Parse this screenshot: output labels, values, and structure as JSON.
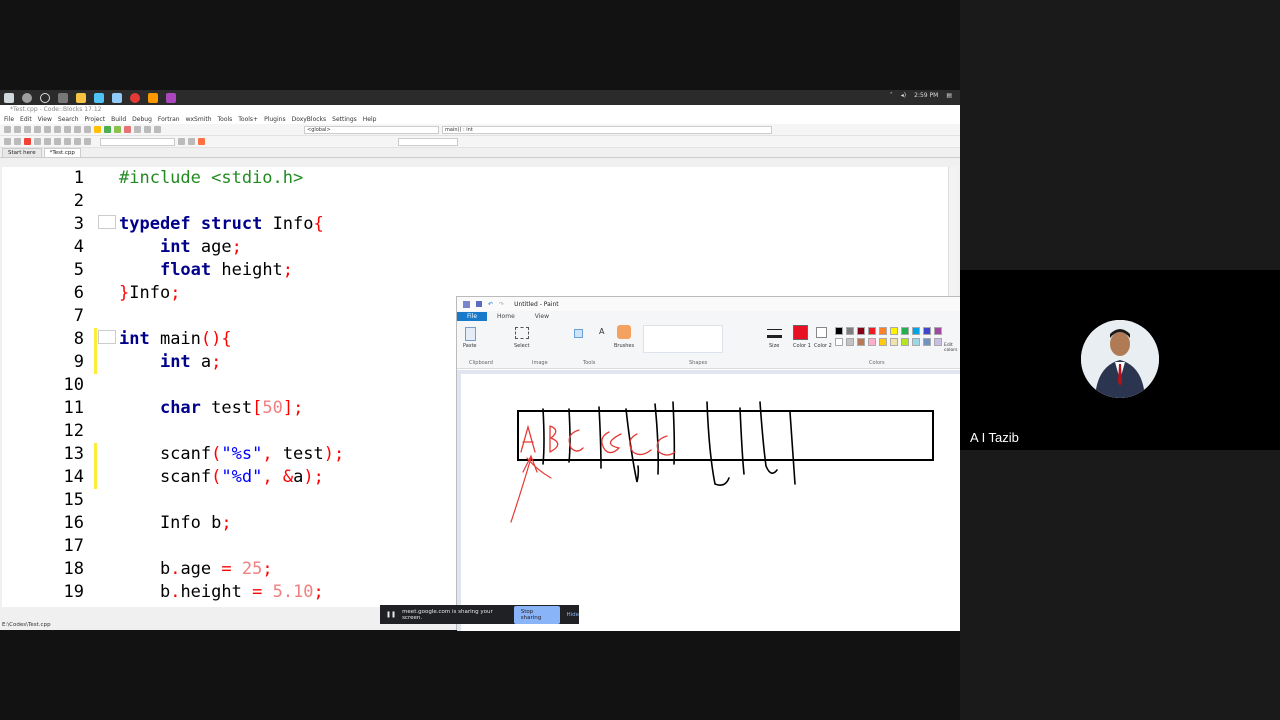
{
  "taskbar": {
    "time": "2:59 PM"
  },
  "ide": {
    "title": "*Test.cpp - Code::Blocks 17.12",
    "menu": [
      "File",
      "Edit",
      "View",
      "Search",
      "Project",
      "Build",
      "Debug",
      "Fortran",
      "wxSmith",
      "Tools",
      "Tools+",
      "Plugins",
      "DoxyBlocks",
      "Settings",
      "Help"
    ],
    "scope_select": "<global>",
    "function_select": "main() : int",
    "tabs": [
      "Start here",
      "*Test.cpp"
    ],
    "status_path": "E:\\Codes\\Test.cpp"
  },
  "editor": {
    "lines": [
      {
        "n": "1"
      },
      {
        "n": "2"
      },
      {
        "n": "3"
      },
      {
        "n": "4"
      },
      {
        "n": "5"
      },
      {
        "n": "6"
      },
      {
        "n": "7"
      },
      {
        "n": "8"
      },
      {
        "n": "9"
      },
      {
        "n": "10"
      },
      {
        "n": "11"
      },
      {
        "n": "12"
      },
      {
        "n": "13"
      },
      {
        "n": "14"
      },
      {
        "n": "15"
      },
      {
        "n": "16"
      },
      {
        "n": "17"
      },
      {
        "n": "18"
      },
      {
        "n": "19"
      }
    ]
  },
  "paint": {
    "title": "Untitled - Paint",
    "tabs": [
      "File",
      "Home",
      "View"
    ],
    "groups": [
      "Clipboard",
      "Image",
      "Tools",
      "Shapes",
      "Colors"
    ],
    "buttons": {
      "paste": "Paste",
      "select": "Select",
      "brushes": "Brushes",
      "size": "Size",
      "color1": "Color 1",
      "color2": "Color 2",
      "edit_colors": "Edit colors"
    },
    "colors": {
      "primary": "#e81123",
      "palette": [
        "#000000",
        "#7f7f7f",
        "#880015",
        "#ed1c24",
        "#ff7f27",
        "#fff200",
        "#22b14c",
        "#00a2e8",
        "#3f48cc",
        "#a349a4",
        "#ffffff",
        "#c3c3c3",
        "#b97a57",
        "#ffaec9",
        "#ffc90e",
        "#efe4b0",
        "#b5e61d",
        "#99d9ea",
        "#7092be",
        "#c8bfe7"
      ]
    }
  },
  "share_bar": {
    "message": "meet.google.com is sharing your screen.",
    "stop": "Stop sharing",
    "hide": "Hide"
  },
  "participant": {
    "name": "A I Tazib"
  }
}
